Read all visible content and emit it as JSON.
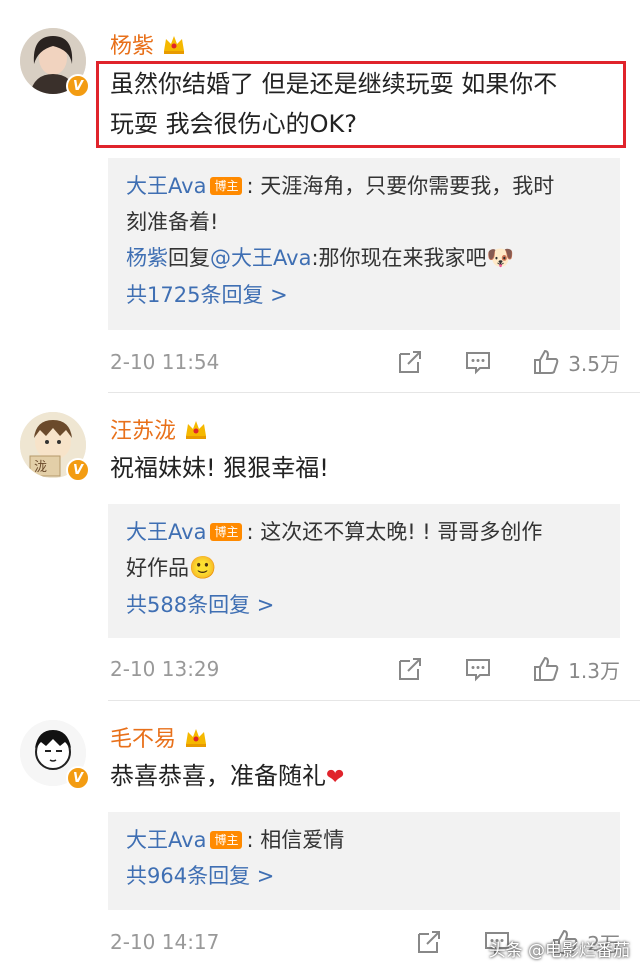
{
  "comments": [
    {
      "username": "杨紫",
      "content_line1": "虽然你结婚了 但是还是继续玩耍 如果你不",
      "content_line2": "玩耍 我会很伤心的OK?",
      "reply1_user": "大王Ava",
      "reply1_badge": "博主",
      "reply1_text_a": ": 天涯海角，只要你需要我，我时",
      "reply1_text_b": "刻准备着!",
      "reply2_user": "杨紫",
      "reply2_verb": "回复",
      "reply2_mention": "@大王Ava",
      "reply2_text": ":那你现在来我家吧",
      "reply2_emoji": "🐶",
      "more_replies": "共1725条回复 >",
      "timestamp": "2-10 11:54",
      "likes": "3.5万"
    },
    {
      "username": "汪苏泷",
      "content_line1": "祝福妹妹! 狠狠幸福!",
      "reply1_user": "大王Ava",
      "reply1_badge": "博主",
      "reply1_text_a": ": 这次还不算太晚! ! 哥哥多创作",
      "reply1_text_b": "好作品",
      "reply1_emoji": "🙂",
      "more_replies": "共588条回复 >",
      "timestamp": "2-10 13:29",
      "likes": "1.3万"
    },
    {
      "username": "毛不易",
      "content_line1": "恭喜恭喜，准备随礼",
      "content_heart": "❤",
      "reply1_user": "大王Ava",
      "reply1_badge": "博主",
      "reply1_text_a": ": 相信爱情",
      "more_replies": "共964条回复 >",
      "timestamp": "2-10 14:17",
      "likes": "2万"
    }
  ],
  "avatar_texts": {
    "c2": "泷"
  },
  "verified_mark": "V",
  "watermark": "头条 @电影烂番茄",
  "colors": {
    "username": "#e8701a",
    "link": "#3f6fb3",
    "highlight": "#e0232b",
    "badge": "#ff8a00"
  }
}
